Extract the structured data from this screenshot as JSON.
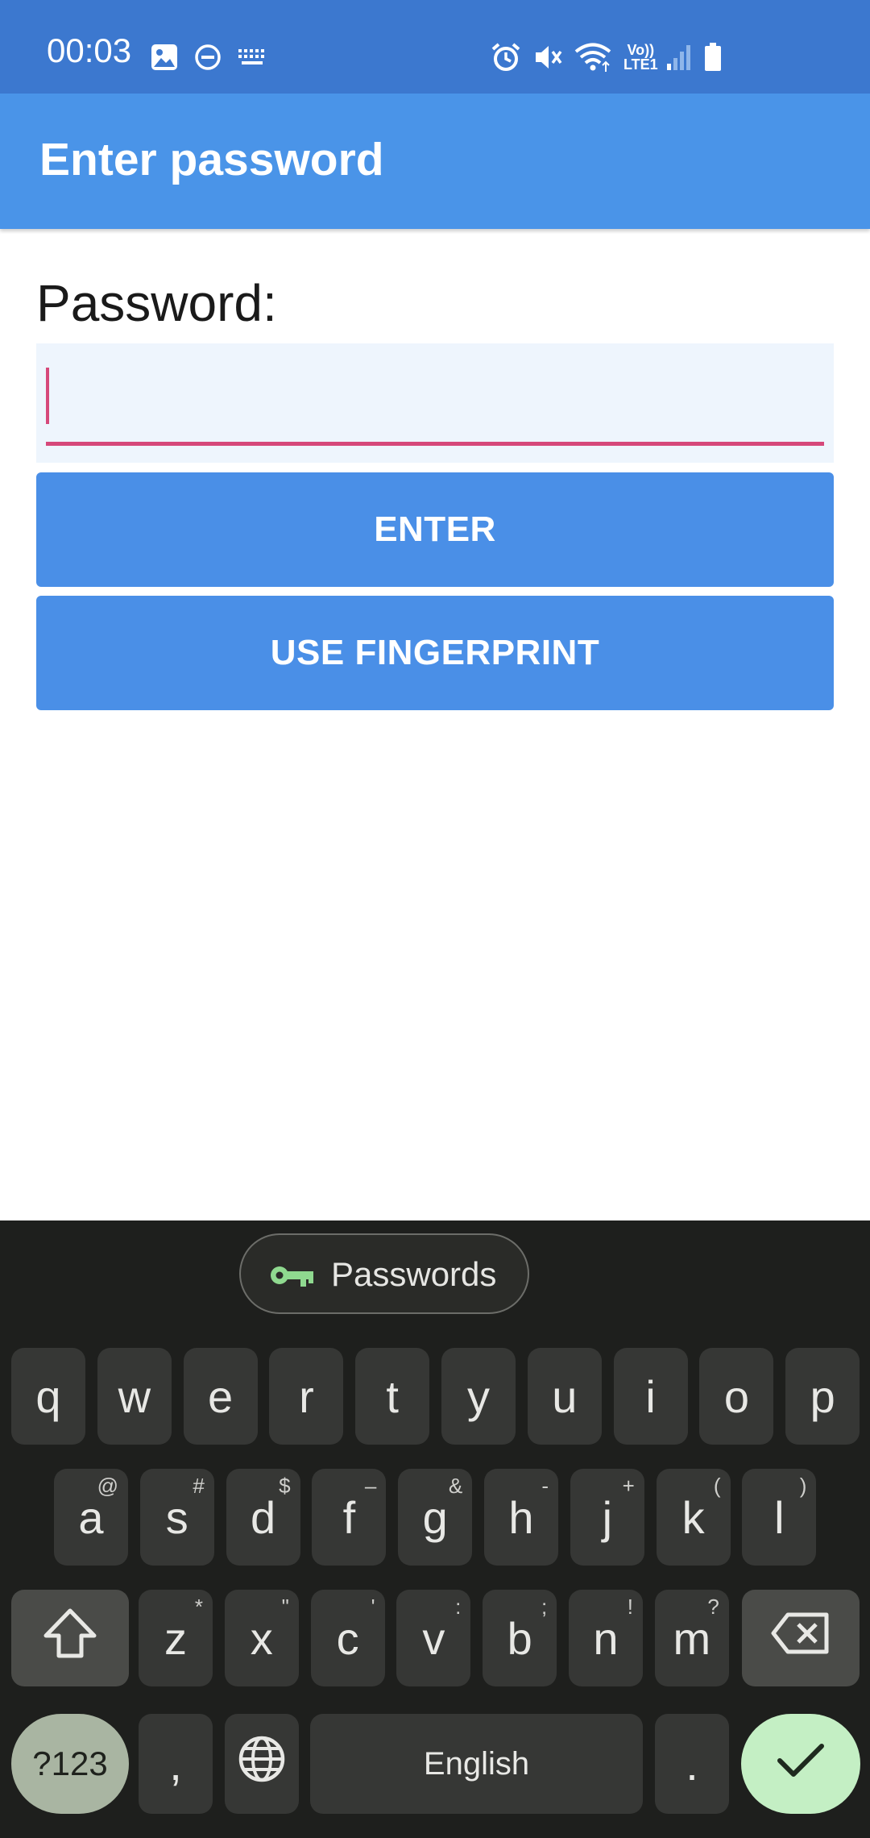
{
  "status_bar": {
    "time": "00:03",
    "left_icons": [
      "image-icon",
      "do-not-disturb-icon",
      "keyboard-icon"
    ],
    "right_icons": [
      "alarm-icon",
      "mute-icon",
      "wifi-icon",
      "volte-icon",
      "signal-icon",
      "battery-icon"
    ],
    "volte_text": "Vo))",
    "lte_text": "LTE1"
  },
  "app_bar": {
    "title": "Enter password"
  },
  "form": {
    "label": "Password:",
    "input_value": "",
    "enter_label": "ENTER",
    "fingerprint_label": "USE FINGERPRINT"
  },
  "keyboard": {
    "suggestion_chip": "Passwords",
    "row1": [
      {
        "k": "q"
      },
      {
        "k": "w"
      },
      {
        "k": "e"
      },
      {
        "k": "r"
      },
      {
        "k": "t"
      },
      {
        "k": "y"
      },
      {
        "k": "u"
      },
      {
        "k": "i"
      },
      {
        "k": "o"
      },
      {
        "k": "p"
      }
    ],
    "row2": [
      {
        "k": "a",
        "s": "@"
      },
      {
        "k": "s",
        "s": "#"
      },
      {
        "k": "d",
        "s": "$"
      },
      {
        "k": "f",
        "s": "–"
      },
      {
        "k": "g",
        "s": "&"
      },
      {
        "k": "h",
        "s": "-"
      },
      {
        "k": "j",
        "s": "+"
      },
      {
        "k": "k",
        "s": "("
      },
      {
        "k": "l",
        "s": ")"
      }
    ],
    "row3": [
      {
        "k": "z",
        "s": "*"
      },
      {
        "k": "x",
        "s": "\""
      },
      {
        "k": "c",
        "s": "'"
      },
      {
        "k": "v",
        "s": ":"
      },
      {
        "k": "b",
        "s": ";"
      },
      {
        "k": "n",
        "s": "!"
      },
      {
        "k": "m",
        "s": "?"
      }
    ],
    "symbols_label": "?123",
    "comma": ",",
    "space_label": "English",
    "period": ".",
    "shift_icon": "shift-icon",
    "backspace_icon": "backspace-icon",
    "globe_icon": "globe-icon",
    "enter_icon": "check-icon"
  },
  "colors": {
    "status_bar": "#3c78cf",
    "app_bar": "#4a94e8",
    "button": "#4a8fe7",
    "field_underline": "#d6487a",
    "keyboard_bg": "#1e1f1d",
    "key_bg": "#363735",
    "confirm_key": "#c4efc4"
  }
}
